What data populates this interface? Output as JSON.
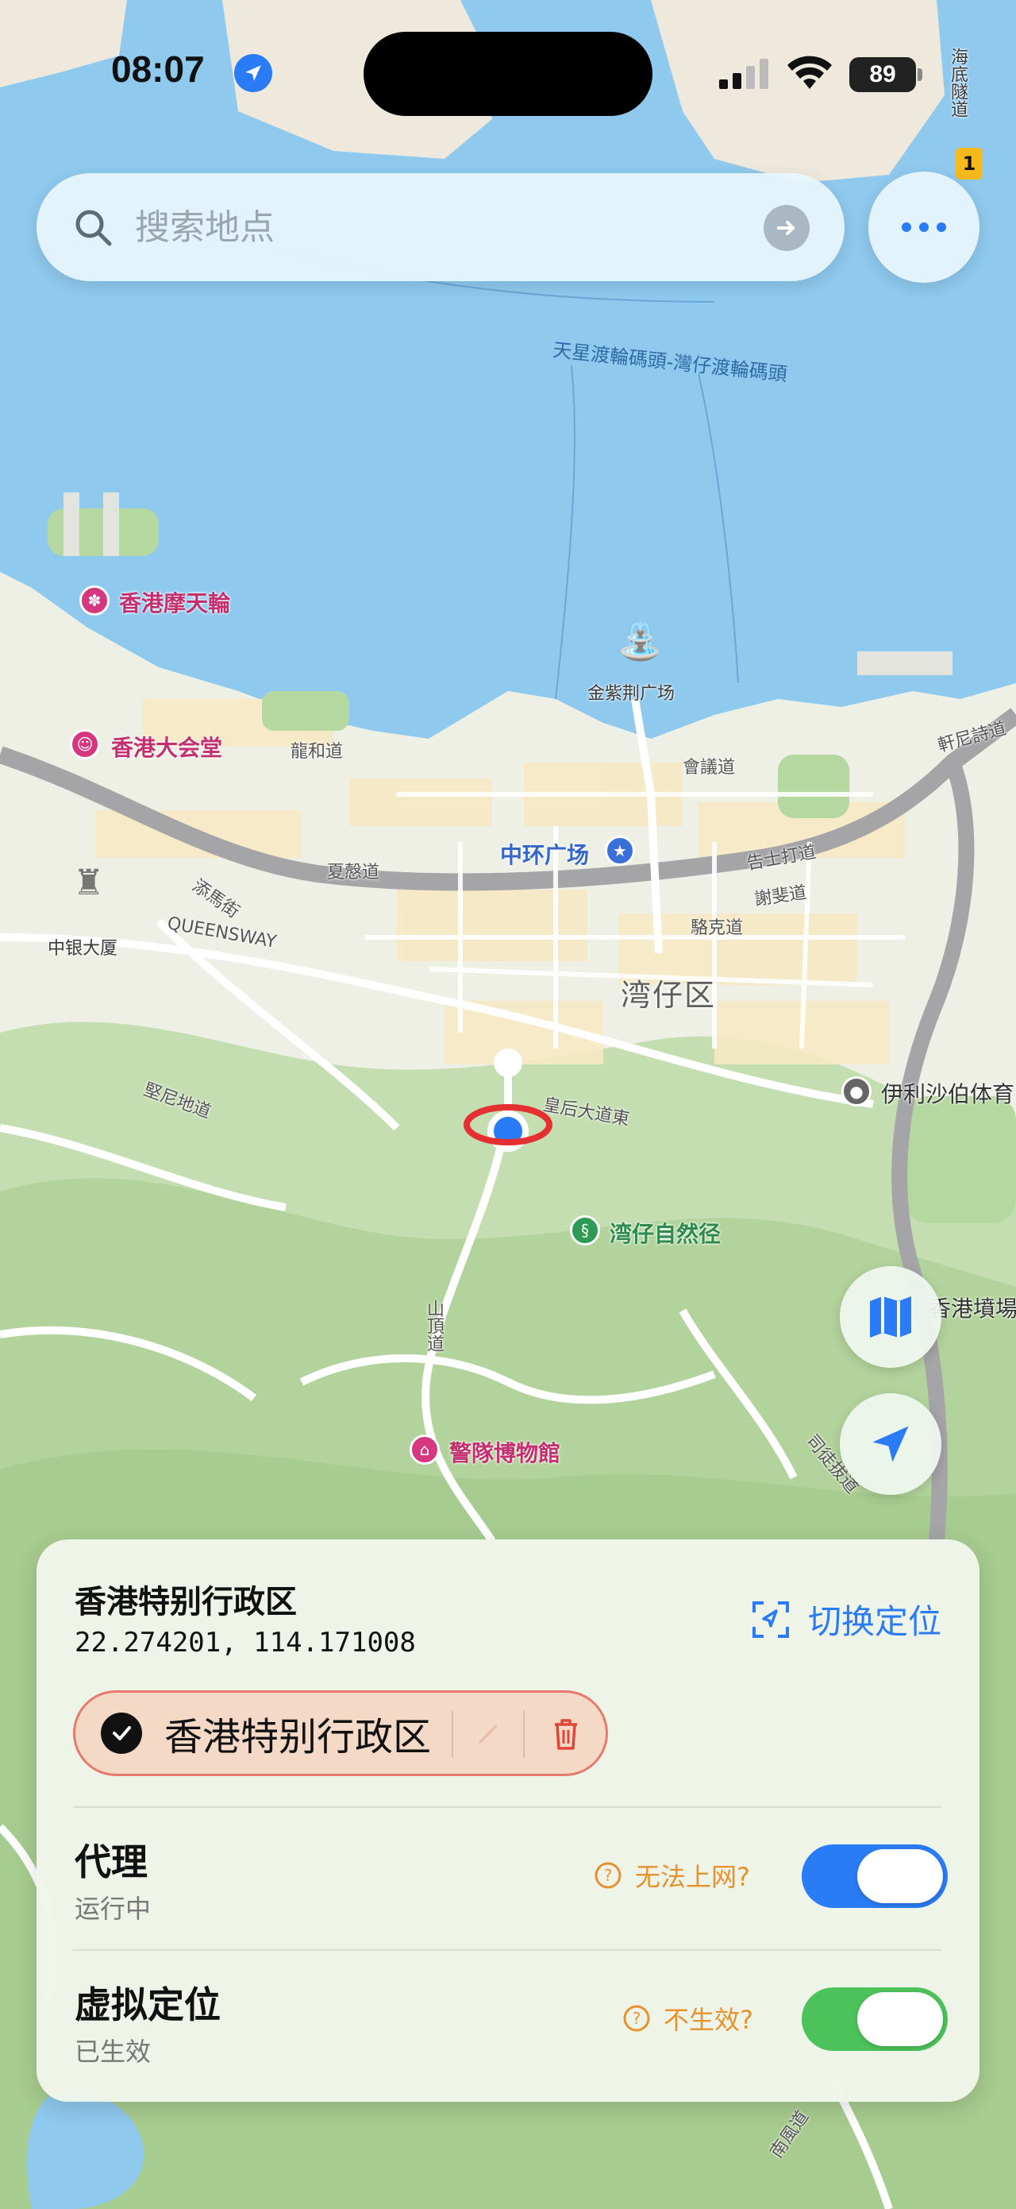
{
  "status_bar": {
    "time": "08:07",
    "battery": "89"
  },
  "search": {
    "placeholder": "搜索地点"
  },
  "map": {
    "labels": {
      "victoria_tunnel": "海底隧道",
      "ferry_line": "天星渡輪碼頭-灣仔渡輪碼頭",
      "ferris_wheel": "香港摩天輪",
      "city_hall": "香港大会堂",
      "bauhinia_square": "金紫荆广场",
      "central_plaza": "中环广场",
      "boc_tower": "中银大厦",
      "district": "湾仔区",
      "wan_chai_nature_trail": "湾仔自然径",
      "elizabeth_stadium": "伊利沙伯体育",
      "police_museum": "警隊博物館",
      "hk_stadium": "香港墳場",
      "queensway": "QUEENSWAY",
      "harcourt_rd": "夏慤道",
      "gloucester_rd": "告士打道",
      "lung_wo_rd": "龍和道",
      "convention_rd": "會議道",
      "queens_rd_east": "皇后大道東",
      "peak_rd": "山頂道",
      "stubbs_rd": "司徒拔道",
      "jaffe_rd": "謝斐道",
      "lockhart_rd": "駱克道",
      "kennedy_rd": "堅尼地道",
      "hennessy_rd": "軒尼詩道",
      "tamar_st": "添馬街",
      "nam_fung_rd": "南風道",
      "highway_badge": "1"
    }
  },
  "panel": {
    "region_name": "香港特别行政区",
    "coordinates": "22.274201, 114.171008",
    "switch_location_label": "切换定位",
    "saved_location_label": "香港特别行政区",
    "proxy": {
      "title": "代理",
      "status": "运行中",
      "help": "无法上网?",
      "enabled": true,
      "color": "#2a7cf6"
    },
    "virtual_location": {
      "title": "虚拟定位",
      "status": "已生效",
      "help": "不生效?",
      "enabled": true,
      "color": "#4cc35a"
    }
  },
  "colors": {
    "accent": "#2a7cf6",
    "warning": "#e8922e",
    "danger": "#e0453a",
    "water": "#7dbfe8",
    "park": "#b5d8a0"
  }
}
